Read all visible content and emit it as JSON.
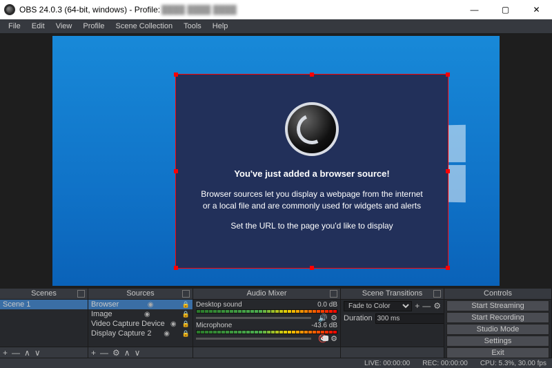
{
  "title": "OBS 24.0.3 (64-bit, windows) - Profile:",
  "menu": [
    "File",
    "Edit",
    "View",
    "Profile",
    "Scene Collection",
    "Tools",
    "Help"
  ],
  "browser_source": {
    "heading": "You've just added a browser source!",
    "line1": "Browser sources let you display a webpage from the internet or a local file and are commonly used for widgets and alerts",
    "line2": "Set the URL to the page you'd like to display"
  },
  "docks": {
    "scenes": {
      "title": "Scenes",
      "items": [
        "Scene 1"
      ]
    },
    "sources": {
      "title": "Sources",
      "items": [
        "Browser",
        "Image",
        "Video Capture Device",
        "Display Capture 2"
      ]
    },
    "mixer": {
      "title": "Audio Mixer",
      "channels": [
        {
          "name": "Desktop sound",
          "db": "0.0 dB",
          "muted": false
        },
        {
          "name": "Microphone",
          "db": "-43.6 dB",
          "muted": true
        }
      ]
    },
    "transitions": {
      "title": "Scene Transitions",
      "mode": "Fade to Color",
      "duration_label": "Duration",
      "duration": "300 ms"
    },
    "controls": {
      "title": "Controls",
      "buttons": [
        "Start Streaming",
        "Start Recording",
        "Studio Mode",
        "Settings",
        "Exit"
      ]
    }
  },
  "status": {
    "live": "LIVE: 00:00:00",
    "rec": "REC: 00:00:00",
    "cpu": "CPU: 5.3%, 30.00 fps"
  }
}
